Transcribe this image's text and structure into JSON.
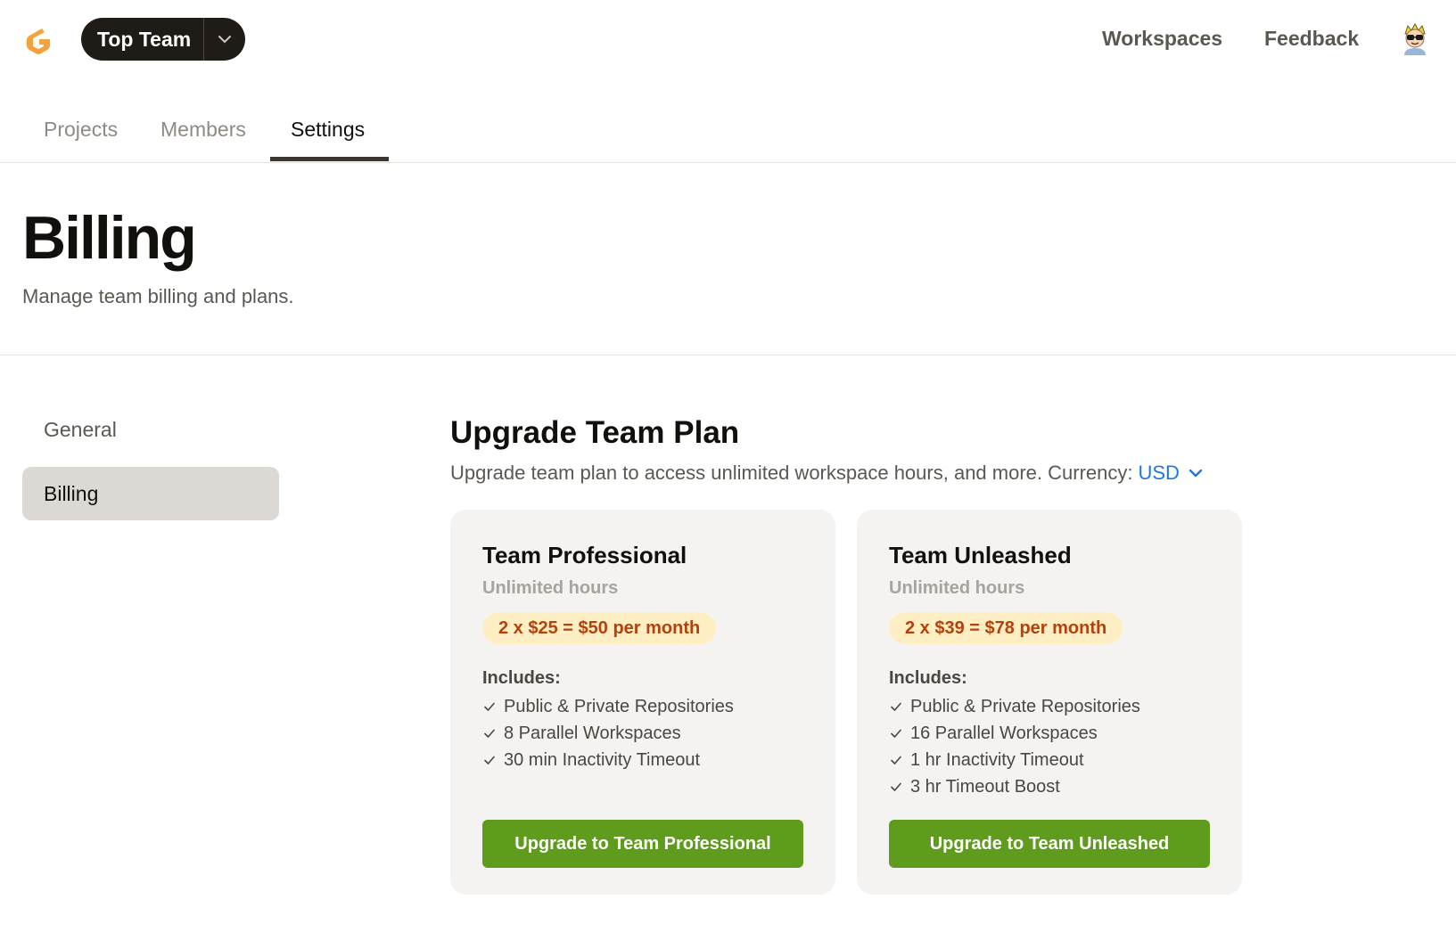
{
  "header": {
    "team_name": "Top Team",
    "nav": {
      "workspaces": "Workspaces",
      "feedback": "Feedback"
    }
  },
  "tabs": [
    {
      "label": "Projects"
    },
    {
      "label": "Members"
    },
    {
      "label": "Settings",
      "active": true
    }
  ],
  "page": {
    "title": "Billing",
    "subtitle": "Manage team billing and plans."
  },
  "sidebar": {
    "items": [
      {
        "label": "General"
      },
      {
        "label": "Billing",
        "active": true
      }
    ]
  },
  "upgrade": {
    "title": "Upgrade Team Plan",
    "description": "Upgrade team plan to access unlimited workspace hours, and more. Currency:",
    "currency": "USD"
  },
  "plans": [
    {
      "name": "Team Professional",
      "hours": "Unlimited hours",
      "price": "2 x $25 = $50 per month",
      "includes_label": "Includes:",
      "features": [
        "Public & Private Repositories",
        "8 Parallel Workspaces",
        "30 min Inactivity Timeout"
      ],
      "button": "Upgrade to Team Professional"
    },
    {
      "name": "Team Unleashed",
      "hours": "Unlimited hours",
      "price": "2 x $39 = $78 per month",
      "includes_label": "Includes:",
      "features": [
        "Public & Private Repositories",
        "16 Parallel Workspaces",
        "1 hr Inactivity Timeout",
        "3 hr Timeout Boost"
      ],
      "button": "Upgrade to Team Unleashed"
    }
  ],
  "colors": {
    "accent_green": "#5f9c1e",
    "price_badge_bg": "#fdefc3",
    "price_badge_text": "#b4420d",
    "link_blue": "#1d78e0",
    "logo_orange": "#f5a23a"
  },
  "icons": {
    "logo": "gitpod-logo-icon",
    "team_dropdown": "chevron-down-icon",
    "avatar": "avatar-icon",
    "currency_dropdown": "chevron-down-icon",
    "feature_check": "check-icon"
  }
}
